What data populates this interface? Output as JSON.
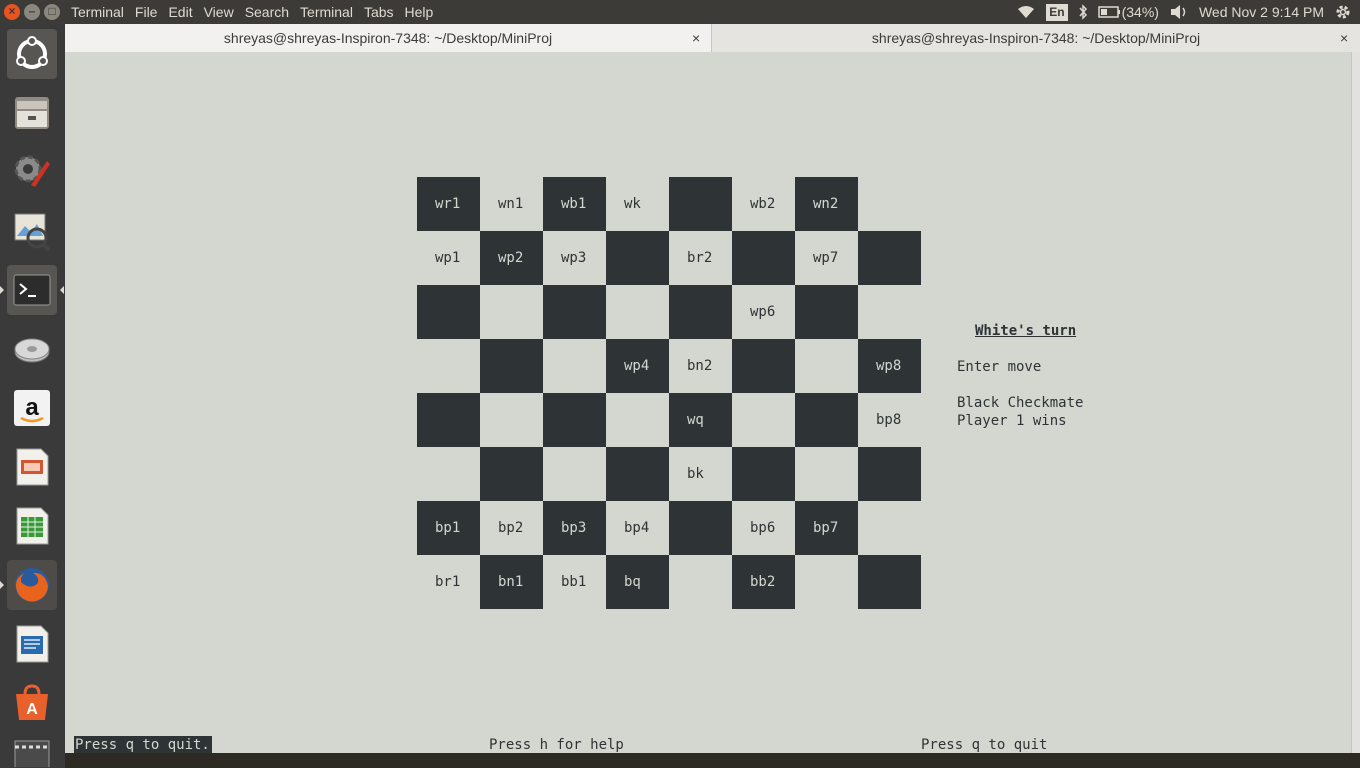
{
  "topbar": {
    "menu": [
      "Terminal",
      "File",
      "Edit",
      "View",
      "Search",
      "Terminal",
      "Tabs",
      "Help"
    ],
    "lang": "En",
    "battery": "(34%)",
    "datetime": "Wed Nov  2  9:14 PM"
  },
  "launcher": {
    "items": [
      "ubuntu-dash-icon",
      "files-icon",
      "system-settings-icon",
      "image-viewer-icon",
      "terminal-icon",
      "disk-icon",
      "amazon-icon",
      "impress-icon",
      "calc-icon",
      "firefox-icon",
      "writer-icon",
      "software-center-icon",
      "video-icon"
    ]
  },
  "tabs": [
    {
      "title": "shreyas@shreyas-Inspiron-7348: ~/Desktop/MiniProj",
      "close": "×"
    },
    {
      "title": "shreyas@shreyas-Inspiron-7348: ~/Desktop/MiniProj",
      "close": "×"
    }
  ],
  "board": [
    [
      "wr1",
      "wn1",
      "wb1",
      "wk",
      "",
      "wb2",
      "wn2",
      ""
    ],
    [
      "wp1",
      "wp2",
      "wp3",
      "",
      "br2",
      "",
      "wp7",
      ""
    ],
    [
      "",
      "",
      "",
      "",
      "",
      "wp6",
      "",
      ""
    ],
    [
      "",
      "",
      "",
      "wp4",
      "bn2",
      "",
      "",
      "wp8"
    ],
    [
      "",
      "",
      "",
      "",
      "wq",
      "",
      "",
      "bp8"
    ],
    [
      "",
      "",
      "",
      "",
      "bk",
      "",
      "",
      ""
    ],
    [
      "bp1",
      "bp2",
      "bp3",
      "bp4",
      "",
      "bp6",
      "bp7",
      ""
    ],
    [
      "br1",
      "bn1",
      "bb1",
      "bq",
      "",
      "bb2",
      "",
      ""
    ]
  ],
  "side": {
    "turn": "White's turn",
    "prompt": "Enter move",
    "message1": "Black Checkmate",
    "message2": "Player 1 wins"
  },
  "status": {
    "left": "Press q to quit.",
    "center": "Press h for help",
    "right": "Press q to quit"
  }
}
